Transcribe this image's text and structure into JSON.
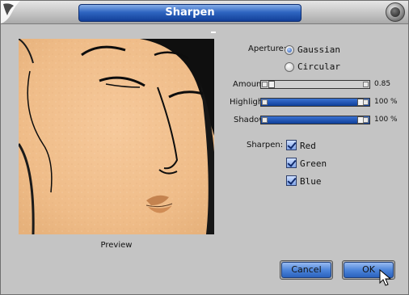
{
  "window": {
    "title": "Sharpen"
  },
  "preview": {
    "label": "Preview"
  },
  "aperture": {
    "label": "Aperture:",
    "options": [
      {
        "label": "Gaussian",
        "selected": true
      },
      {
        "label": "Circular",
        "selected": false
      }
    ]
  },
  "sliders": [
    {
      "label": "Amount",
      "value": "0.85",
      "fill_fraction": 0.0
    },
    {
      "label": "Highlight",
      "value": "100 %",
      "fill_fraction": 1.0
    },
    {
      "label": "Shadow",
      "value": "100 %",
      "fill_fraction": 1.0
    }
  ],
  "sharpen": {
    "label": "Sharpen:",
    "channels": [
      {
        "label": "Red",
        "checked": true
      },
      {
        "label": "Green",
        "checked": true
      },
      {
        "label": "Blue",
        "checked": true
      }
    ]
  },
  "buttons": {
    "cancel": "Cancel",
    "ok": "OK"
  },
  "colors": {
    "accent": "#1f53b0",
    "title_blue": "#2f66c2",
    "skin": "#f2c190"
  }
}
